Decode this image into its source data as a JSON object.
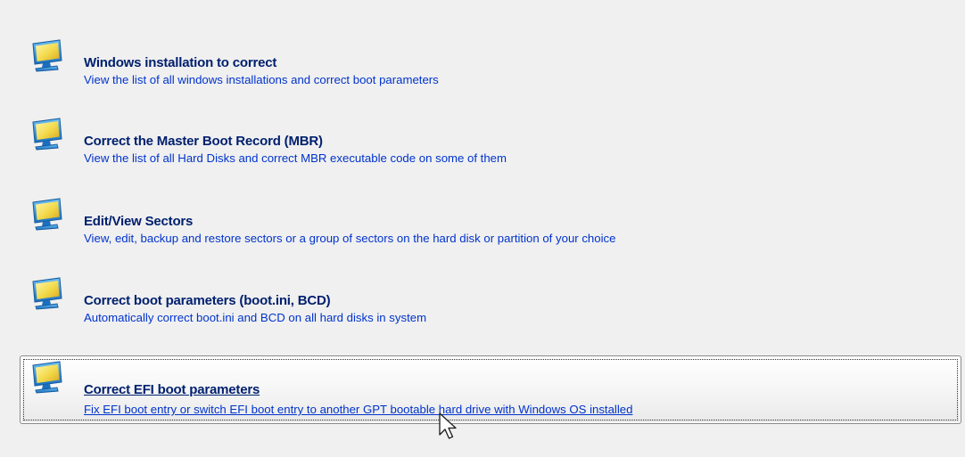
{
  "options": [
    {
      "title": "Windows installation to correct",
      "description": "View the list of all windows installations and correct boot parameters",
      "icon": "monitor-icon",
      "selected": false
    },
    {
      "title": "Correct the Master Boot Record (MBR)",
      "description": "View the list of all Hard Disks and correct MBR executable code on some of them",
      "icon": "monitor-icon",
      "selected": false
    },
    {
      "title": "Edit/View Sectors",
      "description": "View, edit, backup and restore sectors or a group of sectors on the hard disk or partition of your choice",
      "icon": "monitor-icon",
      "selected": false
    },
    {
      "title": "Correct boot parameters (boot.ini, BCD)",
      "description": "Automatically correct boot.ini and BCD on all hard disks in system",
      "icon": "monitor-icon",
      "selected": false
    },
    {
      "title": "Correct EFI boot parameters",
      "description": "Fix EFI boot entry or switch EFI boot entry to another GPT bootable hard drive with Windows OS installed",
      "icon": "monitor-icon",
      "selected": true
    }
  ],
  "colors": {
    "title": "#00206e",
    "description": "#0033cc",
    "background": "#f0f0f0",
    "monitor_frame": "#2b8fd8",
    "monitor_screen": "#f2d94a"
  },
  "cursor_icon": "mouse-pointer-icon"
}
